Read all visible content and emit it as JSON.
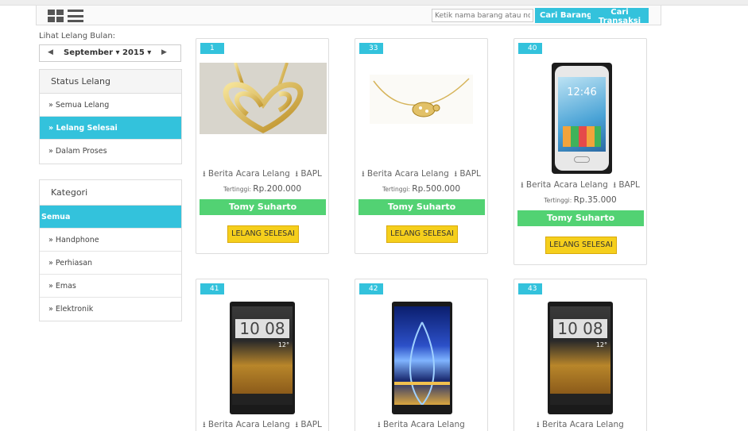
{
  "header": {
    "search_placeholder": "Ketik nama barang atau nomor",
    "btn_cari_barang": "Cari Barang",
    "btn_cari_transaksi": "Cari Transaksi"
  },
  "sidebar": {
    "bulan_label": "Lihat Lelang Bulan:",
    "month": "September ▾ 2015 ▾",
    "status_title": "Status Lelang",
    "status_items": [
      "»  Semua Lelang",
      "»  Lelang Selesai",
      "»  Dalam Proses"
    ],
    "kategori_title": "Kategori",
    "kategori_items": [
      "Semua",
      "»  Handphone",
      "»  Perhiasan",
      "»  Emas",
      "»  Elektronik"
    ]
  },
  "cards": [
    {
      "number": "1",
      "berita": "Berita Acara Lelang",
      "bapl": "BAPL",
      "tertinggi_label": "Tertinggi:",
      "harga": "Rp.200.000",
      "pemenang": "Tomy Suharto",
      "status": "LELANG SELESAI"
    },
    {
      "number": "33",
      "berita": "Berita Acara Lelang",
      "bapl": "BAPL",
      "tertinggi_label": "Tertinggi:",
      "harga": "Rp.500.000",
      "pemenang": "Tomy Suharto",
      "status": "LELANG SELESAI"
    },
    {
      "number": "40",
      "berita": "Berita Acara Lelang",
      "bapl": "BAPL",
      "tertinggi_label": "Tertinggi:",
      "harga": "Rp.35.000",
      "pemenang": "Tomy Suharto",
      "status": "LELANG SELESAI",
      "phone_clock": "12:46"
    },
    {
      "number": "41",
      "berita": "Berita Acara Lelang",
      "bapl": "BAPL",
      "phone_clock": "10 08",
      "phone_temp": "12°"
    },
    {
      "number": "42",
      "berita": "Berita Acara Lelang"
    },
    {
      "number": "43",
      "berita": "Berita Acara Lelang",
      "phone_clock": "10 08",
      "phone_temp": "12°"
    }
  ],
  "colors": {
    "accent": "#33c2dc",
    "winner": "#52d273",
    "status": "#f5cf1c"
  }
}
